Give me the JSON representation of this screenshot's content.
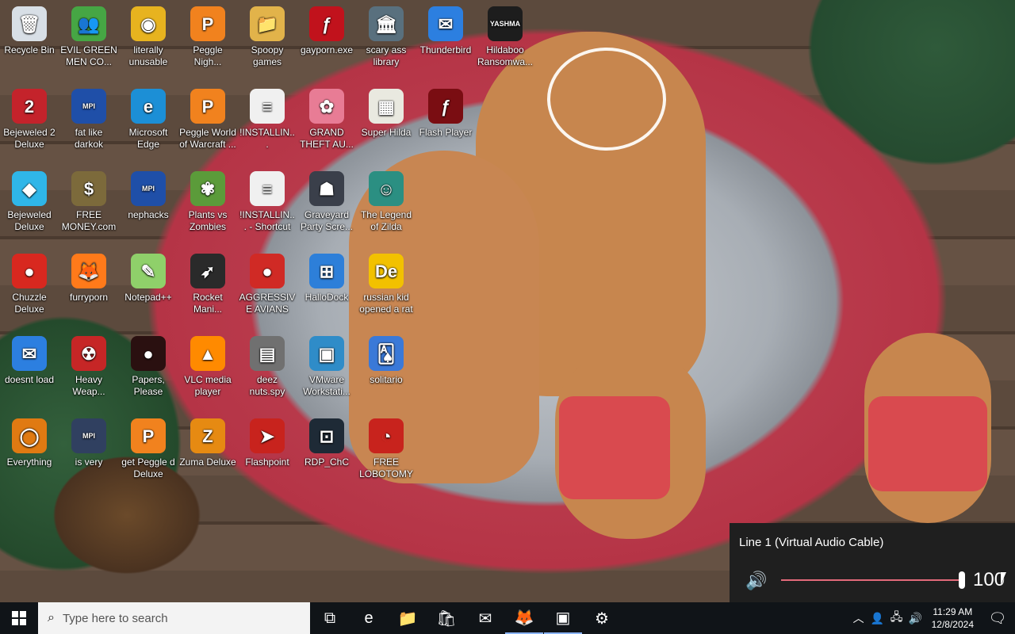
{
  "desktop": {
    "icons": [
      {
        "label": "Recycle Bin",
        "glyph": "🗑",
        "color": "#d8dfe6"
      },
      {
        "label": "EVIL GREEN MEN CO...",
        "glyph": "👥",
        "color": "#46a644"
      },
      {
        "label": "literally unusable",
        "glyph": "◉",
        "color": "#e7b31f"
      },
      {
        "label": "Peggle Nigh...",
        "glyph": "P",
        "color": "#f1821e"
      },
      {
        "label": "Spoopy games",
        "glyph": "📁",
        "color": "#e2b34a"
      },
      {
        "label": "gayporn.exe",
        "glyph": "ƒ",
        "color": "#c1121c"
      },
      {
        "label": "scary ass library",
        "glyph": "🏛",
        "color": "#59707e"
      },
      {
        "label": "Thunderbird",
        "glyph": "✉",
        "color": "#2c7fe0"
      },
      {
        "label": "Hildaboo Ransomwa...",
        "glyph": "YASHMA",
        "color": "#1d1d1d"
      },
      {
        "label": "Bejeweled 2 Deluxe",
        "glyph": "2",
        "color": "#c4232b"
      },
      {
        "label": "fat like darkok",
        "glyph": "MPI",
        "color": "#1f4fa8"
      },
      {
        "label": "Microsoft Edge",
        "glyph": "e",
        "color": "#1c8fd6"
      },
      {
        "label": "Peggle World of Warcraft ...",
        "glyph": "P",
        "color": "#f1821e"
      },
      {
        "label": "!INSTALLIN...",
        "glyph": "≡",
        "color": "#f0f0f0"
      },
      {
        "label": "GRAND THEFT AU...",
        "glyph": "✿",
        "color": "#e87c95"
      },
      {
        "label": "Super Hilda",
        "glyph": "▦",
        "color": "#e9e9e0"
      },
      {
        "label": "Flash Player",
        "glyph": "ƒ",
        "color": "#7a0d12"
      },
      {
        "label": "Bejeweled Deluxe",
        "glyph": "◆",
        "color": "#2fb6e8"
      },
      {
        "label": "FREE MONEY.com",
        "glyph": "$",
        "color": "#7c6a3b"
      },
      {
        "label": "nephacks",
        "glyph": "MPI",
        "color": "#1f4fa8"
      },
      {
        "label": "Plants vs Zombies",
        "glyph": "✾",
        "color": "#5b9b3a"
      },
      {
        "label": "!INSTALLIN... - Shortcut",
        "glyph": "≡",
        "color": "#f0f0f0"
      },
      {
        "label": "Graveyard Party Scre...",
        "glyph": "☗",
        "color": "#3a3f4a"
      },
      {
        "label": "The Legend of Zilda",
        "glyph": "☺",
        "color": "#2b8f82"
      },
      {
        "label": "Chuzzle Deluxe",
        "glyph": "●",
        "color": "#d8281f"
      },
      {
        "label": "furryporn",
        "glyph": "🦊",
        "color": "#ff7a1a"
      },
      {
        "label": "Notepad++",
        "glyph": "✎",
        "color": "#8fd06a"
      },
      {
        "label": "Rocket Mani...",
        "glyph": "➶",
        "color": "#2a2a2a"
      },
      {
        "label": "AGGRESSIVE AVIANS",
        "glyph": "●",
        "color": "#d02a25"
      },
      {
        "label": "HalloDock",
        "glyph": "⊞",
        "color": "#2d7fd9"
      },
      {
        "label": "russian kid opened a rat",
        "glyph": "De",
        "color": "#f2c100"
      },
      {
        "label": "doesnt load",
        "glyph": "✉",
        "color": "#2c7fe0"
      },
      {
        "label": "Heavy Weap...",
        "glyph": "☢",
        "color": "#c62626"
      },
      {
        "label": "Papers, Please",
        "glyph": "●",
        "color": "#2a1010"
      },
      {
        "label": "VLC media player",
        "glyph": "▲",
        "color": "#ff8a00"
      },
      {
        "label": "deez nuts.spy",
        "glyph": "▤",
        "color": "#707070"
      },
      {
        "label": "VMware Workstati...",
        "glyph": "▣",
        "color": "#2f8cc8"
      },
      {
        "label": "solitario",
        "glyph": "🂡",
        "color": "#3a79d8"
      },
      {
        "label": "Everything",
        "glyph": "◯",
        "color": "#e07a12"
      },
      {
        "label": "is very",
        "glyph": "MPI",
        "color": "#304060"
      },
      {
        "label": "get Peggle d Deluxe",
        "glyph": "P",
        "color": "#f1821e"
      },
      {
        "label": "Zuma Deluxe",
        "glyph": "Z",
        "color": "#e68a12"
      },
      {
        "label": "Flashpoint",
        "glyph": "➤",
        "color": "#c8231d"
      },
      {
        "label": "RDP_ChC",
        "glyph": "⊡",
        "color": "#1e2a36"
      },
      {
        "label": "FREE LOBOTOMYS",
        "glyph": "◔",
        "color": "#c8231d"
      }
    ]
  },
  "volume_flyout": {
    "device": "Line 1 (Virtual Audio Cable)",
    "speaker_icon": "speaker-icon",
    "level": 100,
    "level_text": "100"
  },
  "taskbar": {
    "search_placeholder": "Type here to search",
    "apps": [
      {
        "name": "task-view",
        "glyph": "⧉",
        "active": false
      },
      {
        "name": "edge",
        "glyph": "e",
        "active": false
      },
      {
        "name": "file-explorer",
        "glyph": "📁",
        "active": false
      },
      {
        "name": "microsoft-store",
        "glyph": "🛍",
        "active": false
      },
      {
        "name": "mail",
        "glyph": "✉",
        "active": false
      },
      {
        "name": "firefox",
        "glyph": "🦊",
        "active": true
      },
      {
        "name": "vmware",
        "glyph": "▣",
        "active": true
      },
      {
        "name": "settings",
        "glyph": "⚙",
        "active": false
      }
    ],
    "time": "11:29 AM",
    "date": "12/8/2024"
  }
}
